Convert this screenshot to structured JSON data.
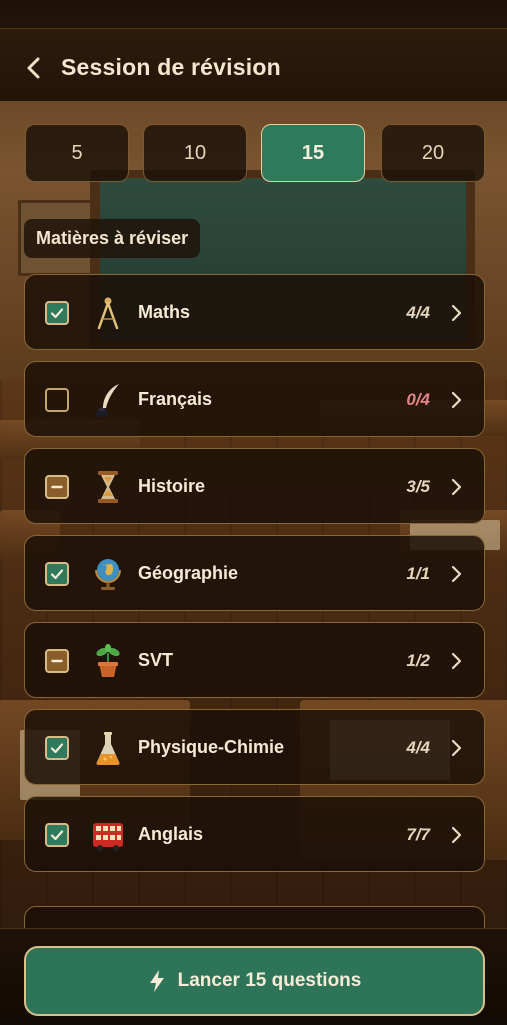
{
  "header": {
    "title": "Session de révision",
    "back_icon": "chevron-left-icon"
  },
  "question_counts": {
    "options": [
      "5",
      "10",
      "15",
      "20"
    ],
    "selected": "15"
  },
  "subjects_section": {
    "label": "Matières à réviser"
  },
  "subjects": [
    {
      "name": "Maths",
      "count": "4/4",
      "state": "checked",
      "icon": "compass-icon"
    },
    {
      "name": "Français",
      "count": "0/4",
      "state": "unchecked",
      "icon": "quill-icon"
    },
    {
      "name": "Histoire",
      "count": "3/5",
      "state": "partial",
      "icon": "hourglass-icon"
    },
    {
      "name": "Géographie",
      "count": "1/1",
      "state": "checked",
      "icon": "globe-icon"
    },
    {
      "name": "SVT",
      "count": "1/2",
      "state": "partial",
      "icon": "plant-icon"
    },
    {
      "name": "Physique-Chimie",
      "count": "4/4",
      "state": "checked",
      "icon": "flask-icon"
    },
    {
      "name": "Anglais",
      "count": "7/7",
      "state": "checked",
      "icon": "bus-icon"
    }
  ],
  "launch_button": {
    "label": "Lancer 15 questions",
    "icon": "lightning-icon"
  },
  "colors": {
    "accent_green": "#2f7a5d",
    "border_gold": "#8a6633",
    "zero_count": "#e0868a"
  }
}
